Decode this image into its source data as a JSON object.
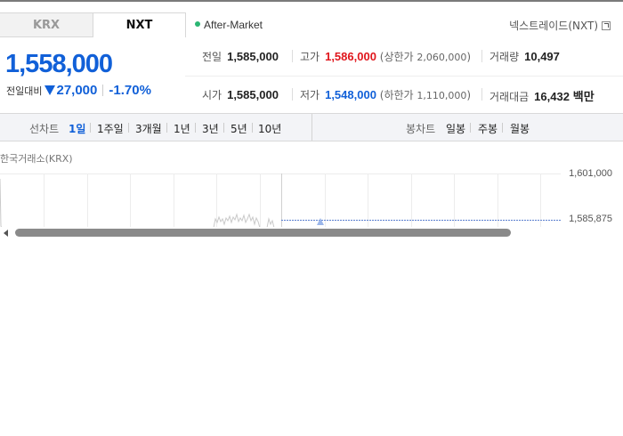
{
  "tabs": [
    {
      "label": "KRX",
      "active": false
    },
    {
      "label": "NXT",
      "active": true
    }
  ],
  "market_status": {
    "label": "After-Market",
    "color": "#2bb673"
  },
  "exchange_link": {
    "label": "넥스트레이드(NXT)"
  },
  "price": {
    "current": "1,558,000",
    "change_label": "전일대비",
    "change_direction": "down",
    "change_amount": "27,000",
    "change_percent": "-1.70%"
  },
  "stats": {
    "prev_close": {
      "label": "전일",
      "value": "1,585,000"
    },
    "high": {
      "label": "고가",
      "value": "1,586,000",
      "sub_label": "상한가",
      "sub_value": "2,060,000"
    },
    "volume": {
      "label": "거래량",
      "value": "10,497"
    },
    "open": {
      "label": "시가",
      "value": "1,585,000"
    },
    "low": {
      "label": "저가",
      "value": "1,548,000",
      "sub_label": "하한가",
      "sub_value": "1,110,000"
    },
    "trade_value": {
      "label": "거래대금",
      "value": "16,432",
      "unit": "백만"
    }
  },
  "period_bar": {
    "line_title": "선차트",
    "line_periods": [
      "1일",
      "1주일",
      "3개월",
      "1년",
      "3년",
      "5년",
      "10년"
    ],
    "active_period": "1일",
    "candle_title": "봉차트",
    "candle_periods": [
      "일봉",
      "주봉",
      "월봉"
    ]
  },
  "chart": {
    "source": "한국거래소(KRX)",
    "y_ticks": [
      "1,601,000",
      "1,585,875"
    ]
  },
  "colors": {
    "up": "#e0161c",
    "down": "#1160d8",
    "accent": "#1160d8"
  }
}
